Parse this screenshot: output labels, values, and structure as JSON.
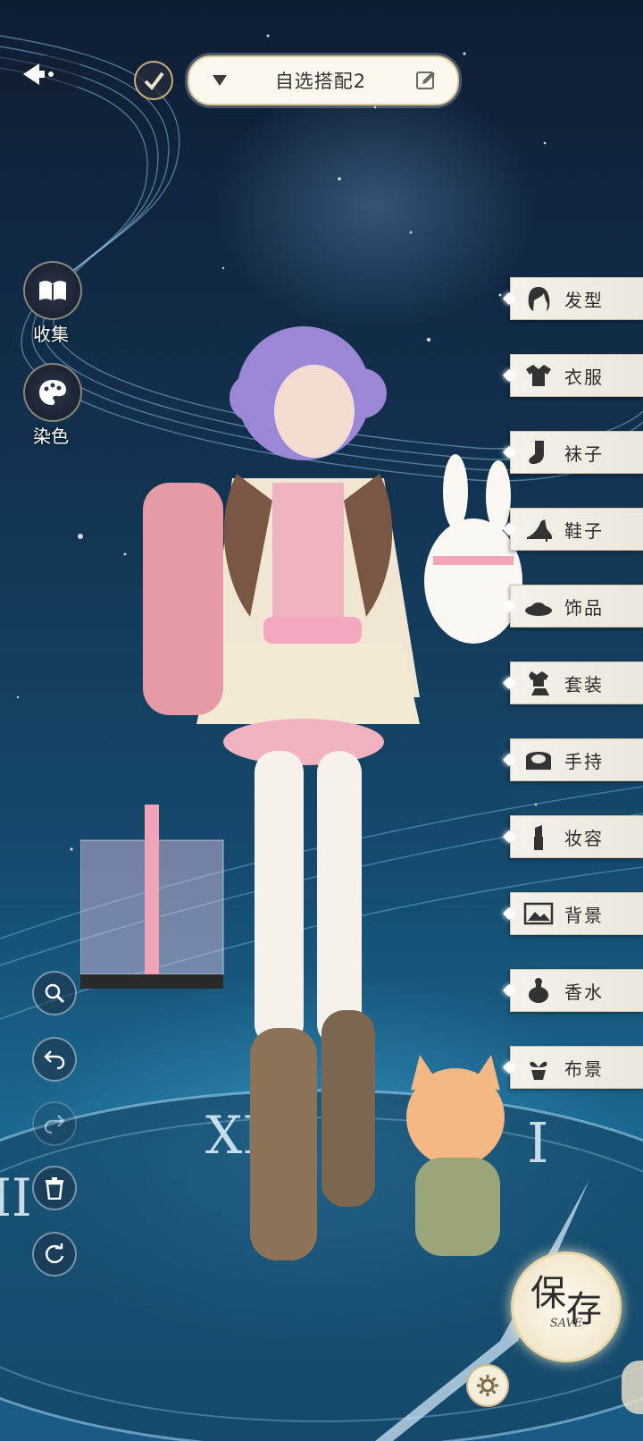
{
  "header": {
    "outfit_name": "自选搭配2"
  },
  "left_panel": {
    "collect_label": "收集",
    "dye_label": "染色"
  },
  "categories": [
    {
      "label": "发型",
      "icon": "hair-icon"
    },
    {
      "label": "衣服",
      "icon": "clothes-icon"
    },
    {
      "label": "袜子",
      "icon": "socks-icon"
    },
    {
      "label": "鞋子",
      "icon": "shoes-icon"
    },
    {
      "label": "饰品",
      "icon": "accessory-icon"
    },
    {
      "label": "套装",
      "icon": "suit-icon"
    },
    {
      "label": "手持",
      "icon": "handheld-icon"
    },
    {
      "label": "妆容",
      "icon": "makeup-icon"
    },
    {
      "label": "背景",
      "icon": "background-icon"
    },
    {
      "label": "香水",
      "icon": "perfume-icon"
    },
    {
      "label": "布景",
      "icon": "scenery-icon"
    }
  ],
  "tools": [
    {
      "name": "zoom",
      "icon": "magnifier-icon"
    },
    {
      "name": "undo",
      "icon": "undo-icon"
    },
    {
      "name": "redo",
      "icon": "redo-icon"
    },
    {
      "name": "delete",
      "icon": "trash-icon"
    },
    {
      "name": "reset",
      "icon": "refresh-icon"
    }
  ],
  "save": {
    "label_1": "保",
    "label_2": "存",
    "sub": "SAVE"
  },
  "clock_numerals": [
    "XI",
    "I",
    "II"
  ],
  "colors": {
    "tab_bg": "#f0ede5",
    "pill_bg": "#fdf8ee",
    "sky_top": "#0f1d33",
    "sky_bottom": "#1b6a92"
  }
}
